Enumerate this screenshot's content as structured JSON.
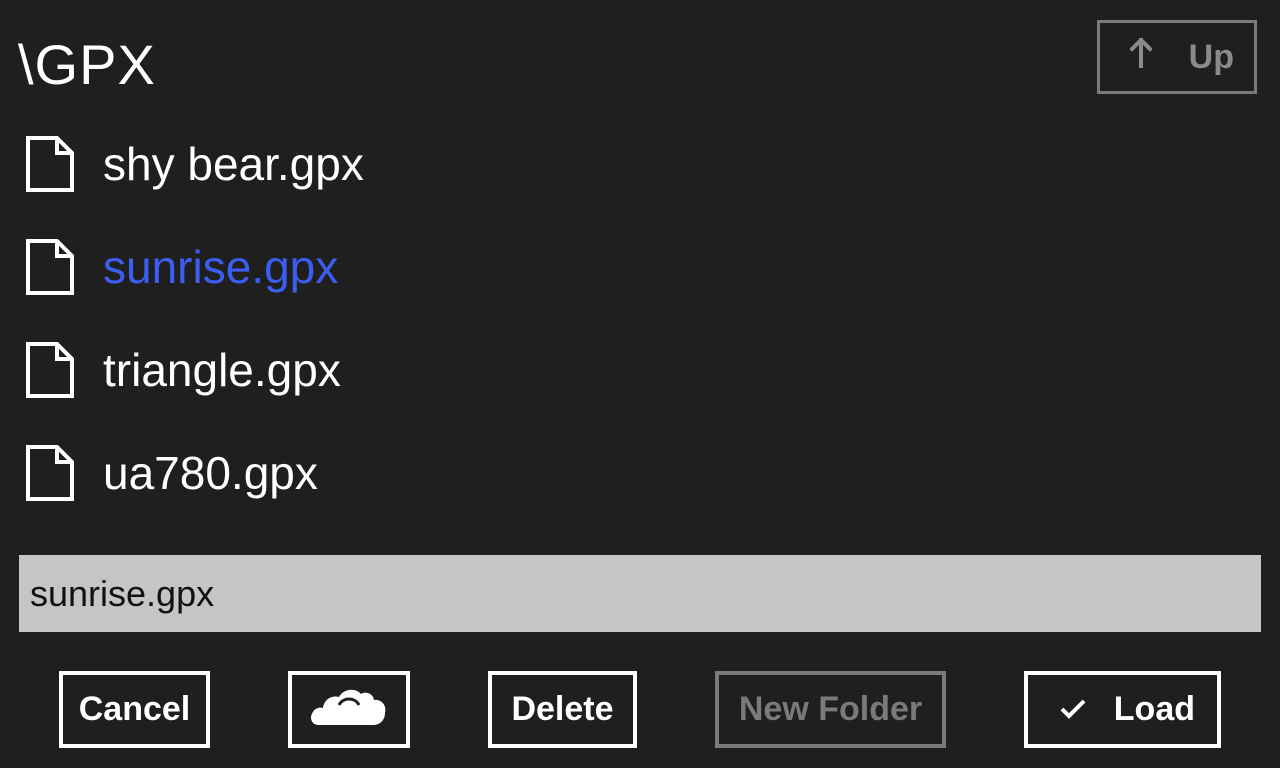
{
  "header": {
    "path": "\\GPX",
    "up_label": "Up",
    "up_icon": "arrow-up-icon"
  },
  "files": [
    {
      "name": "shy bear.gpx",
      "icon": "file-icon",
      "selected": false
    },
    {
      "name": "sunrise.gpx",
      "icon": "file-icon",
      "selected": true
    },
    {
      "name": "triangle.gpx",
      "icon": "file-icon",
      "selected": false
    },
    {
      "name": "ua780.gpx",
      "icon": "file-icon",
      "selected": false
    }
  ],
  "filename_field": {
    "value": "sunrise.gpx"
  },
  "buttons": {
    "cancel": "Cancel",
    "cloud_icon": "onedrive-cloud-icon",
    "delete": "Delete",
    "new_folder": "New Folder",
    "load": "Load",
    "load_icon": "checkmark-icon"
  },
  "colors": {
    "background": "#1f1f1f",
    "selected_text": "#3c5ef0",
    "disabled": "#7a7a7a",
    "input_bg": "#c5c5c5"
  }
}
